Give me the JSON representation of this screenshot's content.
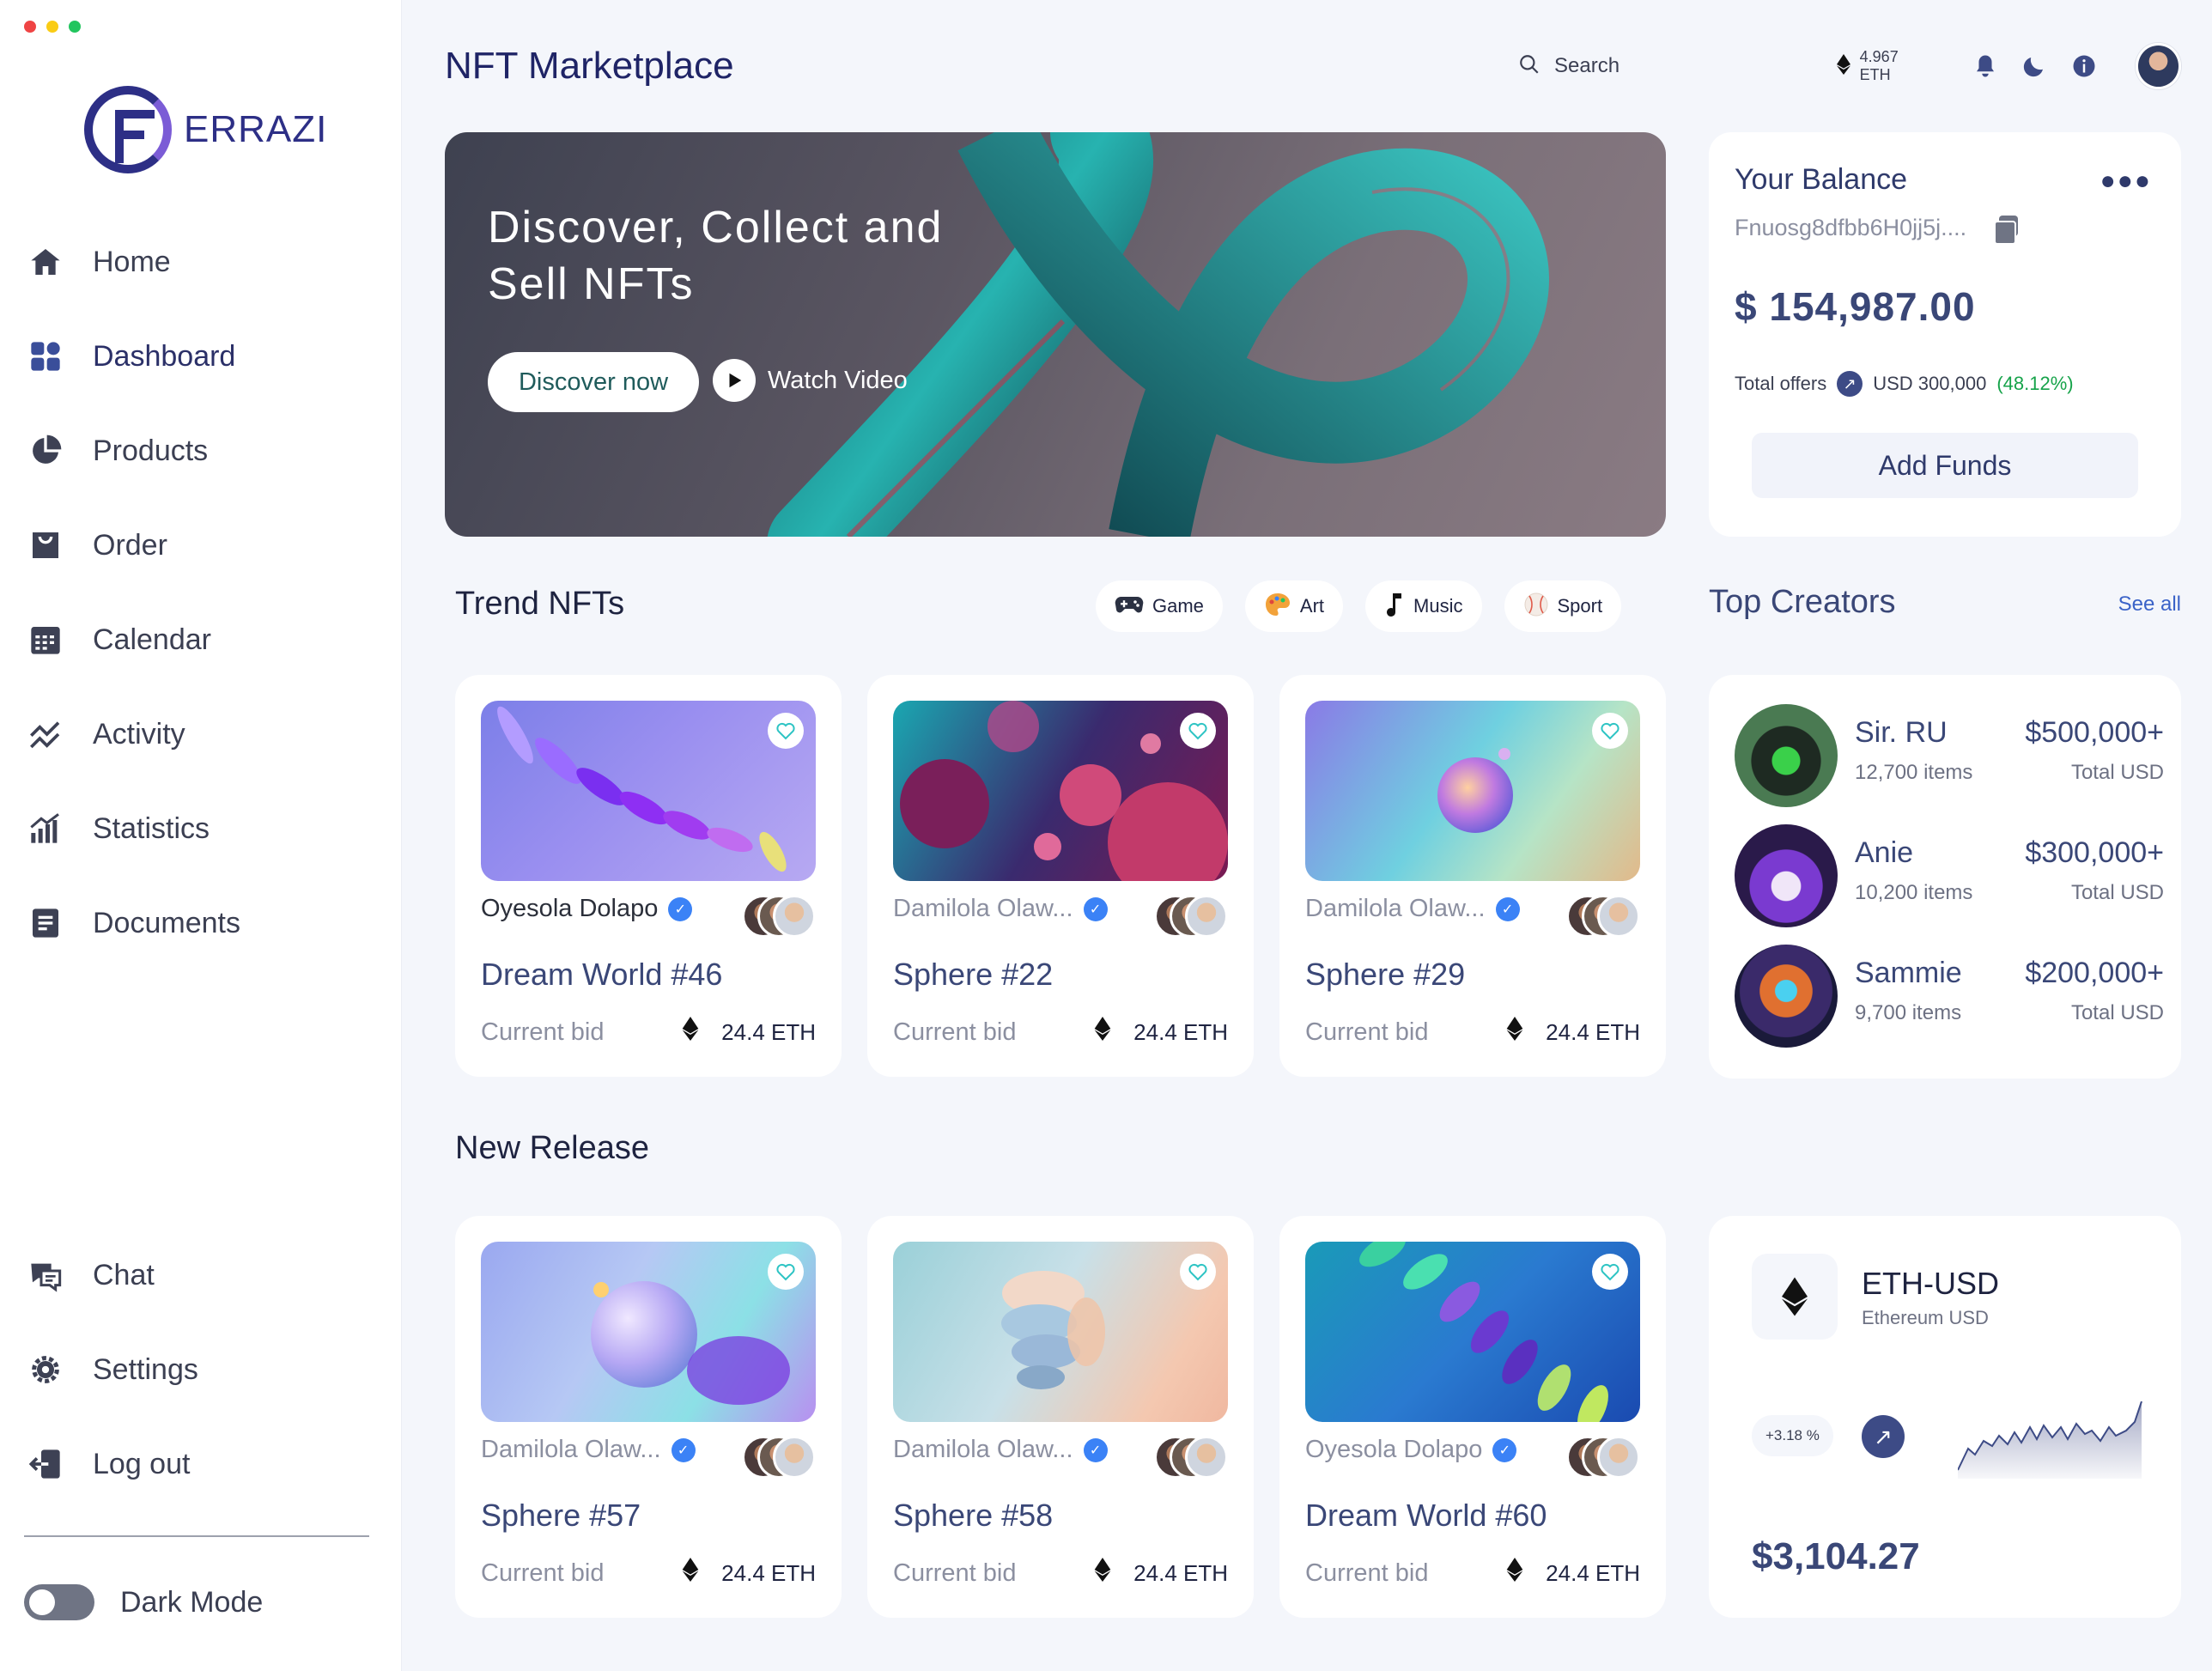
{
  "sidebar": {
    "brand": "ERRAZI",
    "items": [
      {
        "label": "Home",
        "icon": "home-icon"
      },
      {
        "label": "Dashboard",
        "icon": "dashboard-icon"
      },
      {
        "label": "Products",
        "icon": "pie-chart-icon"
      },
      {
        "label": "Order",
        "icon": "bag-icon"
      },
      {
        "label": "Calendar",
        "icon": "calendar-icon"
      },
      {
        "label": "Activity",
        "icon": "activity-icon"
      },
      {
        "label": "Statistics",
        "icon": "bar-chart-icon"
      },
      {
        "label": "Documents",
        "icon": "document-icon"
      }
    ],
    "bottom_items": [
      {
        "label": "Chat",
        "icon": "chat-icon"
      },
      {
        "label": "Settings",
        "icon": "gear-icon"
      },
      {
        "label": "Log out",
        "icon": "logout-icon"
      }
    ],
    "dark_mode_label": "Dark Mode"
  },
  "header": {
    "title": "NFT Marketplace",
    "search_placeholder": "Search",
    "eth_balance": "4.967 ETH"
  },
  "hero": {
    "title": "Discover, Collect and Sell NFTs",
    "primary_button": "Discover now",
    "secondary_button": "Watch Video"
  },
  "balance": {
    "title": "Your Balance",
    "address": "Fnuosg8dfbb6H0jj5j....",
    "amount": "$ 154,987.00",
    "offers_label": "Total offers",
    "offers_value": "USD 300,000",
    "offers_pct": "(48.12%)",
    "button": "Add Funds"
  },
  "trend": {
    "title": "Trend NFTs",
    "categories": [
      {
        "label": "Game",
        "icon": "gamepad-icon"
      },
      {
        "label": "Art",
        "icon": "palette-icon"
      },
      {
        "label": "Music",
        "icon": "music-note-icon"
      },
      {
        "label": "Sport",
        "icon": "baseball-icon"
      }
    ],
    "cards": [
      {
        "author": "Oyesola Dolapo",
        "name": "Dream World #46",
        "bid_label": "Current bid",
        "bid": "24.4 ETH"
      },
      {
        "author": "Damilola Olaw...",
        "name": "Sphere #22",
        "bid_label": "Current bid",
        "bid": "24.4 ETH"
      },
      {
        "author": "Damilola Olaw...",
        "name": "Sphere #29",
        "bid_label": "Current bid",
        "bid": "24.4 ETH"
      }
    ]
  },
  "new_release": {
    "title": "New Release",
    "cards": [
      {
        "author": "Damilola Olaw...",
        "name": "Sphere #57",
        "bid_label": "Current bid",
        "bid": "24.4 ETH"
      },
      {
        "author": "Damilola Olaw...",
        "name": "Sphere #58",
        "bid_label": "Current bid",
        "bid": "24.4 ETH"
      },
      {
        "author": "Oyesola Dolapo",
        "name": "Dream World #60",
        "bid_label": "Current bid",
        "bid": "24.4 ETH"
      }
    ]
  },
  "creators": {
    "title": "Top Creators",
    "see_all": "See all",
    "list": [
      {
        "name": "Sir. RU",
        "items": "12,700 items",
        "amount": "$500,000+",
        "unit": "Total USD"
      },
      {
        "name": "Anie",
        "items": "10,200 items",
        "amount": "$300,000+",
        "unit": "Total USD"
      },
      {
        "name": "Sammie",
        "items": "9,700 items",
        "amount": "$200,000+",
        "unit": "Total USD"
      }
    ]
  },
  "eth_widget": {
    "pair": "ETH-USD",
    "subtitle": "Ethereum USD",
    "change": "+3.18 %",
    "price": "$3,104.27"
  },
  "colors": {
    "brand": "#2d2f86",
    "accent": "#3a4777",
    "positive": "#16a34a",
    "link": "#3b63c8"
  }
}
